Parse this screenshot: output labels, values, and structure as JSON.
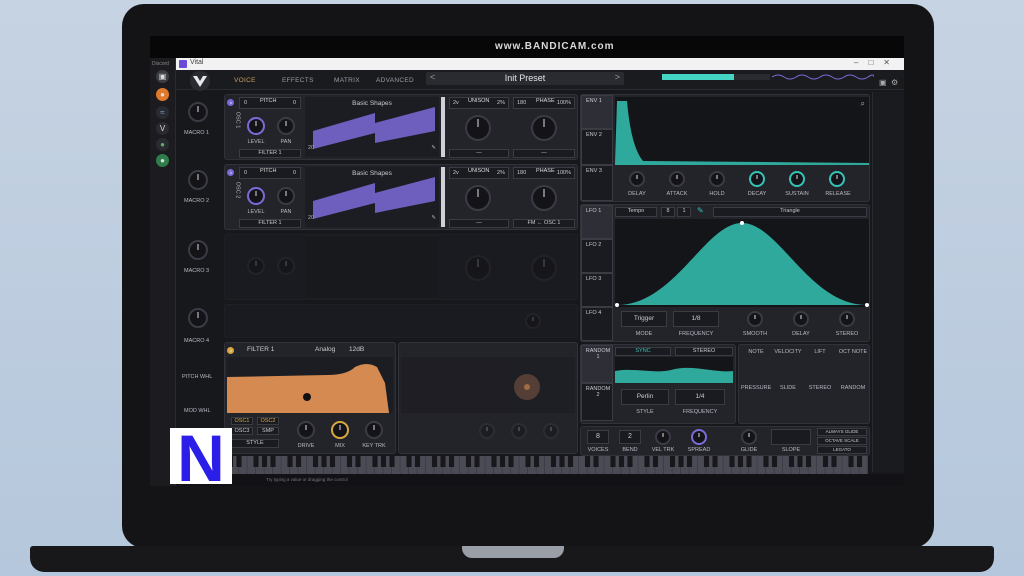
{
  "window": {
    "app_name": "Vital",
    "watermark": "www.BANDICAM.com"
  },
  "left_strip": {
    "label": "Discord"
  },
  "tabs": [
    {
      "label": "VOICE",
      "active": true
    },
    {
      "label": "EFFECTS",
      "active": false
    },
    {
      "label": "MATRIX",
      "active": false
    },
    {
      "label": "ADVANCED",
      "active": false
    }
  ],
  "preset": {
    "name": "Init Preset",
    "prev": "<",
    "next": ">"
  },
  "macros": [
    {
      "label": "MACRO 1"
    },
    {
      "label": "MACRO 2"
    },
    {
      "label": "MACRO 3"
    },
    {
      "label": "MACRO 4"
    }
  ],
  "wheels": {
    "pitch": "PITCH WHL",
    "mod": "MOD WHL"
  },
  "osc1": {
    "side_label": "OSC 1",
    "pitch_label": "PITCH",
    "pitch_left": "0",
    "pitch_right": "0",
    "level_label": "LEVEL",
    "pan_label": "PAN",
    "filter_dest": "FILTER 1",
    "wavetable_name": "Basic Shapes",
    "frame_number": "20",
    "unison_label": "UNISON",
    "unison_voices": "2v",
    "unison_detune": "2%",
    "phase_label": "PHASE",
    "phase_value": "180",
    "phase_random": "100%",
    "dest_left": "—",
    "dest_right": "—"
  },
  "osc2": {
    "side_label": "OSC 2",
    "pitch_label": "PITCH",
    "pitch_left": "0",
    "pitch_right": "0",
    "level_label": "LEVEL",
    "pan_label": "PAN",
    "filter_dest": "FILTER 1",
    "wavetable_name": "Basic Shapes",
    "frame_number": "20",
    "unison_label": "UNISON",
    "unison_voices": "2v",
    "unison_detune": "2%",
    "phase_label": "PHASE",
    "phase_value": "180",
    "phase_random": "100%",
    "dest_left": "—",
    "dest_right": "FM ← OSC 1"
  },
  "envelopes": {
    "tabs": [
      "ENV 1",
      "ENV 2",
      "ENV 3"
    ],
    "params": [
      "DELAY",
      "ATTACK",
      "HOLD",
      "DECAY",
      "SUSTAIN",
      "RELEASE"
    ]
  },
  "lfo": {
    "tabs": [
      "LFO 1",
      "LFO 2",
      "LFO 3",
      "LFO 4"
    ],
    "sync_label": "Tempo",
    "grid_x": "8",
    "grid_y": "1",
    "shape_name": "Triangle",
    "mode_value": "Trigger",
    "mode_label": "MODE",
    "frequency_value": "1/8",
    "frequency_label": "FREQUENCY",
    "smooth_label": "SMOOTH",
    "delay_label": "DELAY",
    "stereo_label": "STEREO"
  },
  "random": {
    "tabs": [
      "RANDOM 1",
      "RANDOM 2"
    ],
    "sync_label": "SYNC",
    "stereo_label": "STEREO",
    "style_value": "Perlin",
    "style_label": "STYLE",
    "frequency_value": "1/4",
    "frequency_label": "FREQUENCY"
  },
  "mod_sources": {
    "top": [
      "NOTE",
      "VELOCITY",
      "LIFT",
      "OCT NOTE"
    ],
    "bottom": [
      "PRESSURE",
      "SLIDE",
      "STEREO",
      "RANDOM"
    ]
  },
  "filter1": {
    "title": "FILTER 1",
    "model": "Analog",
    "slope": "12dB",
    "osc1": "OSC1",
    "osc2": "OSC2",
    "osc3": "OSC3",
    "smp": "SMP",
    "style": "STYLE",
    "drive_label": "DRIVE",
    "mix_label": "MIX",
    "keytrk_label": "KEY TRK"
  },
  "voice": {
    "voices_value": "8",
    "voices_label": "VOICES",
    "bend_value": "2",
    "bend_label": "BEND",
    "vel_trk_label": "VEL TRK",
    "spread_label": "SPREAD",
    "glide_label": "GLIDE",
    "slope_label": "SLOPE",
    "legato_label": "LEGATO",
    "octave_scale": "OCTAVE SCALE",
    "always_glide": "ALWAYS GLIDE"
  },
  "status": {
    "hint": "Try typing a value or dragging the control"
  },
  "logo_n": {
    "letter": "N"
  },
  "colors": {
    "accent_purple": "#7d6ad8",
    "teal": "#35c3b5",
    "filter_orange": "#d58a52",
    "brand_n": "#2a1ee8"
  }
}
